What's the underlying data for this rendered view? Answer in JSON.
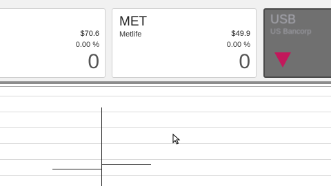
{
  "tiles": [
    {
      "price": "$70.6",
      "pct": "0.00 %",
      "change": "0"
    },
    {
      "symbol": "MET",
      "name": "Metlife",
      "price": "$49.9",
      "pct": "0.00 %",
      "change": "0"
    },
    {
      "symbol": "USB",
      "name": "US Bancorp",
      "direction": "down"
    }
  ],
  "colors": {
    "down_accent": "#c2185b",
    "selected_tile": "#707070"
  },
  "icons": {
    "cursor": "arrow-pointer-icon",
    "trend": "down-triangle-icon"
  }
}
